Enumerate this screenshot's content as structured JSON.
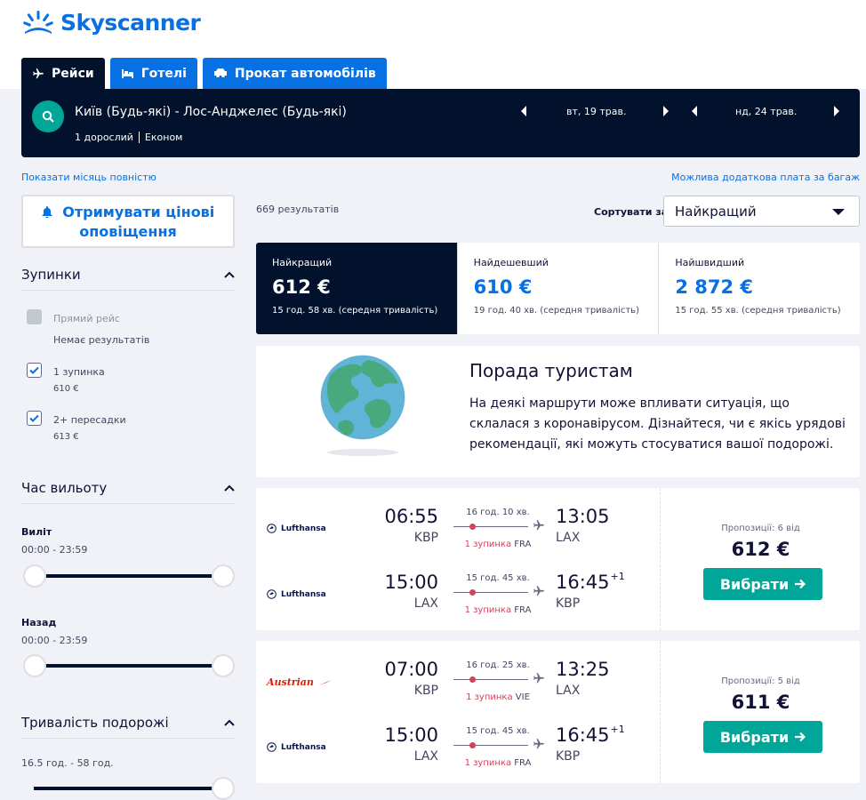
{
  "brand": {
    "name": "Skyscanner",
    "color": "#0770e3"
  },
  "tabs": [
    {
      "label": "Рейси",
      "icon": "plane-icon",
      "active": true
    },
    {
      "label": "Готелі",
      "icon": "bed-icon",
      "active": false
    },
    {
      "label": "Прокат автомобілів",
      "icon": "car-icon",
      "active": false
    }
  ],
  "search": {
    "route": "Київ (Будь-які) - Лос-Анджелес (Будь-які)",
    "passengers": "1 дорослий",
    "cabin": "Економ",
    "depart_date": "вт, 19 трав.",
    "return_date": "нд, 24 трав."
  },
  "links": {
    "show_month": "Показати місяць повністю",
    "baggage": "Можлива додаткова плата за багаж"
  },
  "price_alert": "Отримувати цінові оповіщення",
  "filters": {
    "stops": {
      "title": "Зупинки",
      "options": [
        {
          "label": "Прямий рейс",
          "sub": "Немає результатів",
          "checked": false,
          "disabled": true
        },
        {
          "label": "1 зупинка",
          "sub": "610 €",
          "checked": true,
          "disabled": false
        },
        {
          "label": "2+ пересадки",
          "sub": "613 €",
          "checked": true,
          "disabled": false
        }
      ]
    },
    "departure_time": {
      "title": "Час вильоту",
      "outbound_label": "Виліт",
      "outbound_range": "00:00 - 23:59",
      "return_label": "Назад",
      "return_range": "00:00 - 23:59"
    },
    "duration": {
      "title": "Тривалість подорожі",
      "range": "16.5 год. - 58 год."
    }
  },
  "results": {
    "count": "669 результатів",
    "sort_label": "Сортувати за",
    "sort_value": "Найкращий"
  },
  "sort_tabs": [
    {
      "title": "Найкращий",
      "price": "612 €",
      "duration": "15 год. 58 хв. (середня тривалість)",
      "active": true
    },
    {
      "title": "Найдешевший",
      "price": "610 €",
      "duration": "19 год. 40 хв. (середня тривалість)",
      "active": false
    },
    {
      "title": "Найшвидший",
      "price": "2 872 €",
      "duration": "15 год. 55 хв. (середня тривалість)",
      "active": false
    }
  ],
  "advice": {
    "title": "Порада туристам",
    "text": "На деякі маршрути може впливати ситуація, що склалася з коронавірусом. Дізнайтеся, чи є якісь урядові рекомендації, які можуть стосуватися вашої подорожі."
  },
  "itineraries": [
    {
      "offers": "Пропозиції: 6 від",
      "price": "612 €",
      "button": "Вибрати",
      "legs": [
        {
          "airline": "Lufthansa",
          "dep_time": "06:55",
          "dep_code": "KBP",
          "arr_time": "13:05",
          "arr_plus": "",
          "arr_code": "LAX",
          "duration": "16 год. 10 хв.",
          "stops": "1 зупинка",
          "via": "FRA"
        },
        {
          "airline": "Lufthansa",
          "dep_time": "15:00",
          "dep_code": "LAX",
          "arr_time": "16:45",
          "arr_plus": "+1",
          "arr_code": "KBP",
          "duration": "15 год. 45 хв.",
          "stops": "1 зупинка",
          "via": "FRA"
        }
      ]
    },
    {
      "offers": "Пропозиції: 5 від",
      "price": "611 €",
      "button": "Вибрати",
      "legs": [
        {
          "airline": "Austrian",
          "dep_time": "07:00",
          "dep_code": "KBP",
          "arr_time": "13:25",
          "arr_plus": "",
          "arr_code": "LAX",
          "duration": "16 год. 25 хв.",
          "stops": "1 зупинка",
          "via": "VIE"
        },
        {
          "airline": "Lufthansa",
          "dep_time": "15:00",
          "dep_code": "LAX",
          "arr_time": "16:45",
          "arr_plus": "+1",
          "arr_code": "KBP",
          "duration": "15 год. 45 хв.",
          "stops": "1 зупинка",
          "via": "FRA"
        }
      ]
    }
  ]
}
